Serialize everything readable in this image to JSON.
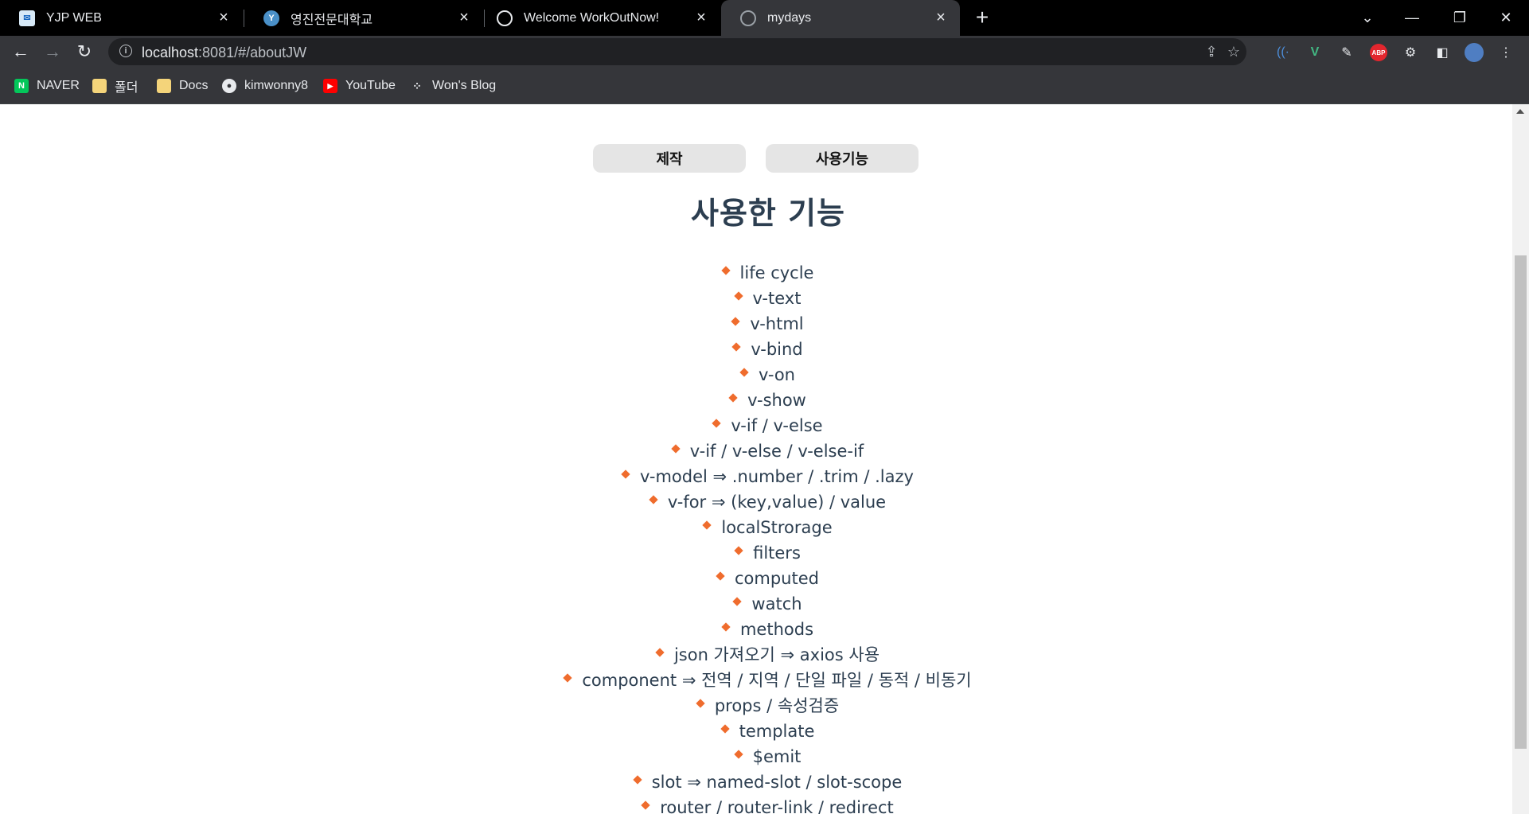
{
  "tabs": [
    {
      "title": "YJP WEB",
      "icon": "yjp-icon",
      "active": false
    },
    {
      "title": "영진전문대학교",
      "icon": "yju-icon",
      "active": false
    },
    {
      "title": "Welcome WorkOutNow!",
      "icon": "globe-icon",
      "active": false
    },
    {
      "title": "mydays",
      "icon": "globe-icon",
      "active": true
    }
  ],
  "address_bar": {
    "host": "localhost",
    "rest": ":8081/#/aboutJW"
  },
  "bookmarks": [
    {
      "label": "NAVER",
      "icon": "naver-icon"
    },
    {
      "label": "폴더",
      "icon": "folder-icon"
    },
    {
      "label": "Docs",
      "icon": "folder-icon"
    },
    {
      "label": "kimwonny8",
      "icon": "github-icon"
    },
    {
      "label": "YouTube",
      "icon": "youtube-icon"
    },
    {
      "label": "Won's Blog",
      "icon": "blog-icon"
    }
  ],
  "page": {
    "buttons": {
      "made_label": "제작",
      "features_label": "사용기능"
    },
    "heading": "사용한 기능",
    "features": [
      "life cycle",
      "v-text",
      "v-html",
      "v-bind",
      "v-on",
      "v-show",
      "v-if / v-else",
      "v-if / v-else / v-else-if",
      "v-model ⇒ .number / .trim / .lazy",
      "v-for ⇒ (key,value) / value",
      "localStrorage",
      "filters",
      "computed",
      "watch",
      "methods",
      "json 가져오기 ⇒ axios 사용",
      "component ⇒ 전역 / 지역 / 단일 파일 / 동적 / 비동기",
      "props / 속성검증",
      "template",
      "$emit",
      "slot ⇒ named-slot / slot-scope",
      "router / router-link / redirect"
    ]
  },
  "colors": {
    "bullet": "#ef6c2d",
    "heading": "#2c3e50",
    "button_bg": "#e5e5e5"
  }
}
